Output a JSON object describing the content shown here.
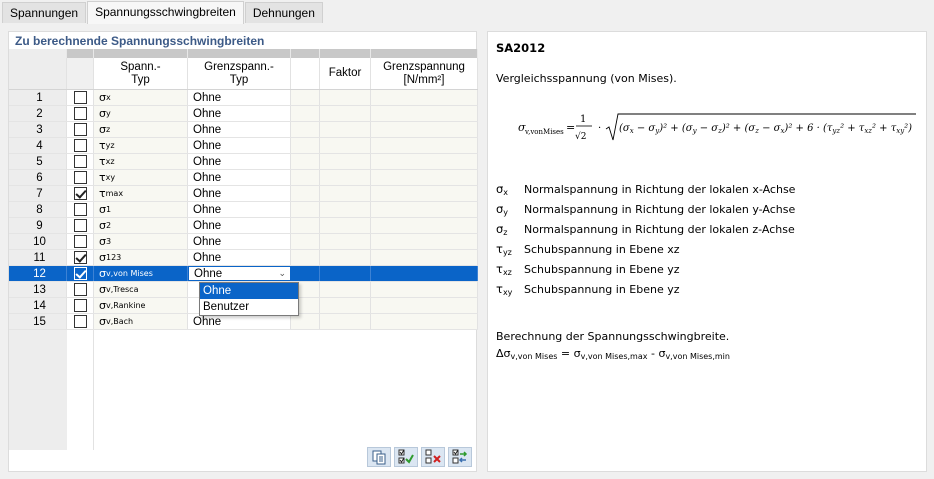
{
  "tabs": [
    {
      "label": "Spannungen",
      "active": false
    },
    {
      "label": "Spannungsschwingbreiten",
      "active": true
    },
    {
      "label": "Dehnungen",
      "active": false
    }
  ],
  "left_panel": {
    "title": "Zu berechnende Spannungsschwingbreiten",
    "columns": {
      "spann_typ": [
        "Spann.-",
        "Typ"
      ],
      "grenz_typ": [
        "Grenzspann.-",
        "Typ"
      ],
      "faktor": "Faktor",
      "grenzspannung": [
        "Grenzspannung",
        "[N/mm²]"
      ]
    },
    "rows": [
      {
        "num": "1",
        "checked": false,
        "sym": "σ",
        "sub": "x",
        "grenz": "Ohne"
      },
      {
        "num": "2",
        "checked": false,
        "sym": "σ",
        "sub": "y",
        "grenz": "Ohne"
      },
      {
        "num": "3",
        "checked": false,
        "sym": "σ",
        "sub": "z",
        "grenz": "Ohne"
      },
      {
        "num": "4",
        "checked": false,
        "sym": "τ",
        "sub": "yz",
        "grenz": "Ohne"
      },
      {
        "num": "5",
        "checked": false,
        "sym": "τ",
        "sub": "xz",
        "grenz": "Ohne"
      },
      {
        "num": "6",
        "checked": false,
        "sym": "τ",
        "sub": "xy",
        "grenz": "Ohne"
      },
      {
        "num": "7",
        "checked": true,
        "sym": "τ",
        "sub": "max",
        "grenz": "Ohne"
      },
      {
        "num": "8",
        "checked": false,
        "sym": "σ",
        "sub": "1",
        "grenz": "Ohne"
      },
      {
        "num": "9",
        "checked": false,
        "sym": "σ",
        "sub": "2",
        "grenz": "Ohne"
      },
      {
        "num": "10",
        "checked": false,
        "sym": "σ",
        "sub": "3",
        "grenz": "Ohne"
      },
      {
        "num": "11",
        "checked": true,
        "sym": "σ",
        "sub": "123",
        "grenz": "Ohne"
      },
      {
        "num": "12",
        "checked": true,
        "sym": "σ",
        "sub": "v,von Mises",
        "grenz": "Ohne",
        "selected": true
      },
      {
        "num": "13",
        "checked": false,
        "sym": "σ",
        "sub": "v,Tresca",
        "grenz": ""
      },
      {
        "num": "14",
        "checked": false,
        "sym": "σ",
        "sub": "v,Rankine",
        "grenz": ""
      },
      {
        "num": "15",
        "checked": false,
        "sym": "σ",
        "sub": "v,Bach",
        "grenz": "Ohne"
      }
    ],
    "dropdown_options": [
      "Ohne",
      "Benutzer"
    ],
    "dropdown_highlighted": "Ohne",
    "toolbar_icons": [
      "copy-table-icon",
      "check-all-icon",
      "uncheck-all-icon",
      "toggle-check-icon"
    ]
  },
  "right_panel": {
    "title": "SA2012",
    "subtitle": "Vergleichsspannung (von Mises).",
    "formula_lhs": "σv,vonMises",
    "legend": [
      {
        "sym": "σ",
        "sub": "x",
        "text": "Normalspannung in Richtung der lokalen x-Achse"
      },
      {
        "sym": "σ",
        "sub": "y",
        "text": "Normalspannung in Richtung der lokalen y-Achse"
      },
      {
        "sym": "σ",
        "sub": "z",
        "text": "Normalspannung in Richtung der lokalen z-Achse"
      },
      {
        "sym": "τ",
        "sub": "yz",
        "text": "Schubspannung in Ebene xz"
      },
      {
        "sym": "τ",
        "sub": "xz",
        "text": "Schubspannung in Ebene yz"
      },
      {
        "sym": "τ",
        "sub": "xy",
        "text": "Schubspannung in Ebene yz"
      }
    ],
    "calc_title": "Berechnung der Spannungsschwingbreite.",
    "calc_formula": {
      "lhs_sym": "Δσ",
      "lhs_sub": "v,von Mises",
      "a_sym": "σ",
      "a_sub": "v,von Mises,max",
      "b_sym": "σ",
      "b_sub": "v,von Mises,min"
    }
  }
}
